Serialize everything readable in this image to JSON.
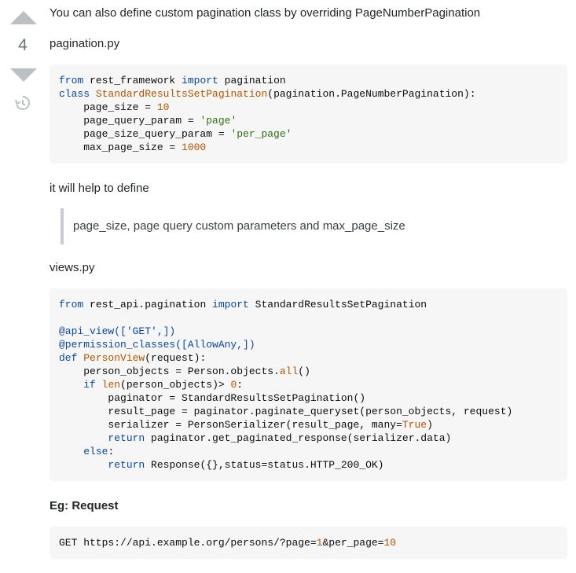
{
  "vote": {
    "count": "4"
  },
  "answer": {
    "intro": "You can also define custom pagination class by overriding PageNumberPagination",
    "file1": "pagination.py",
    "code1": [
      [
        {
          "t": "kw",
          "v": "from"
        },
        {
          "t": "",
          "v": " rest_framework "
        },
        {
          "t": "kw",
          "v": "import"
        },
        {
          "t": "",
          "v": " pagination"
        }
      ],
      [
        {
          "t": "kw",
          "v": "class"
        },
        {
          "t": "",
          "v": " "
        },
        {
          "t": "fn",
          "v": "StandardResultsSetPagination"
        },
        {
          "t": "",
          "v": "(pagination.PageNumberPagination):"
        }
      ],
      [
        {
          "t": "",
          "v": "    page_size = "
        },
        {
          "t": "num",
          "v": "10"
        }
      ],
      [
        {
          "t": "",
          "v": "    page_query_param = "
        },
        {
          "t": "str",
          "v": "'page'"
        }
      ],
      [
        {
          "t": "",
          "v": "    page_size_query_param = "
        },
        {
          "t": "str",
          "v": "'per_page'"
        }
      ],
      [
        {
          "t": "",
          "v": "    max_page_size = "
        },
        {
          "t": "num",
          "v": "1000"
        }
      ]
    ],
    "help_text": "it will help to define",
    "quote": "page_size, page query custom parameters and max_page_size",
    "file2": "views.py",
    "code2": [
      [
        {
          "t": "kw",
          "v": "from"
        },
        {
          "t": "",
          "v": " rest_api.pagination "
        },
        {
          "t": "kw",
          "v": "import"
        },
        {
          "t": "",
          "v": " StandardResultsSetPagination"
        }
      ],
      [],
      [
        {
          "t": "dec",
          "v": "@api_view(['GET',])"
        }
      ],
      [
        {
          "t": "dec",
          "v": "@permission_classes([AllowAny,])"
        }
      ],
      [
        {
          "t": "kw",
          "v": "def"
        },
        {
          "t": "",
          "v": " "
        },
        {
          "t": "fn",
          "v": "PersonView"
        },
        {
          "t": "",
          "v": "(request):"
        }
      ],
      [
        {
          "t": "",
          "v": "    person_objects = Person.objects."
        },
        {
          "t": "builtin",
          "v": "all"
        },
        {
          "t": "",
          "v": "()"
        }
      ],
      [
        {
          "t": "",
          "v": "    "
        },
        {
          "t": "kw",
          "v": "if"
        },
        {
          "t": "",
          "v": " "
        },
        {
          "t": "builtin",
          "v": "len"
        },
        {
          "t": "",
          "v": "(person_objects)> "
        },
        {
          "t": "num",
          "v": "0"
        },
        {
          "t": "",
          "v": ":"
        }
      ],
      [
        {
          "t": "",
          "v": "        paginator = StandardResultsSetPagination()"
        }
      ],
      [
        {
          "t": "",
          "v": "        result_page = paginator.paginate_queryset(person_objects, request)"
        }
      ],
      [
        {
          "t": "",
          "v": "        serializer = PersonSerializer(result_page, many="
        },
        {
          "t": "num",
          "v": "True"
        },
        {
          "t": "",
          "v": ")"
        }
      ],
      [
        {
          "t": "",
          "v": "        "
        },
        {
          "t": "kw",
          "v": "return"
        },
        {
          "t": "",
          "v": " paginator.get_paginated_response(serializer.data)"
        }
      ],
      [
        {
          "t": "",
          "v": "    "
        },
        {
          "t": "kw",
          "v": "else"
        },
        {
          "t": "",
          "v": ":"
        }
      ],
      [
        {
          "t": "",
          "v": "        "
        },
        {
          "t": "kw",
          "v": "return"
        },
        {
          "t": "",
          "v": " Response({},status=status.HTTP_200_OK)"
        }
      ]
    ],
    "request_heading": "Eg: Request",
    "code3": [
      [
        {
          "t": "",
          "v": "GET https://api.example.org/persons/?page="
        },
        {
          "t": "num",
          "v": "1"
        },
        {
          "t": "",
          "v": "&per_page="
        },
        {
          "t": "num",
          "v": "10"
        }
      ]
    ]
  }
}
